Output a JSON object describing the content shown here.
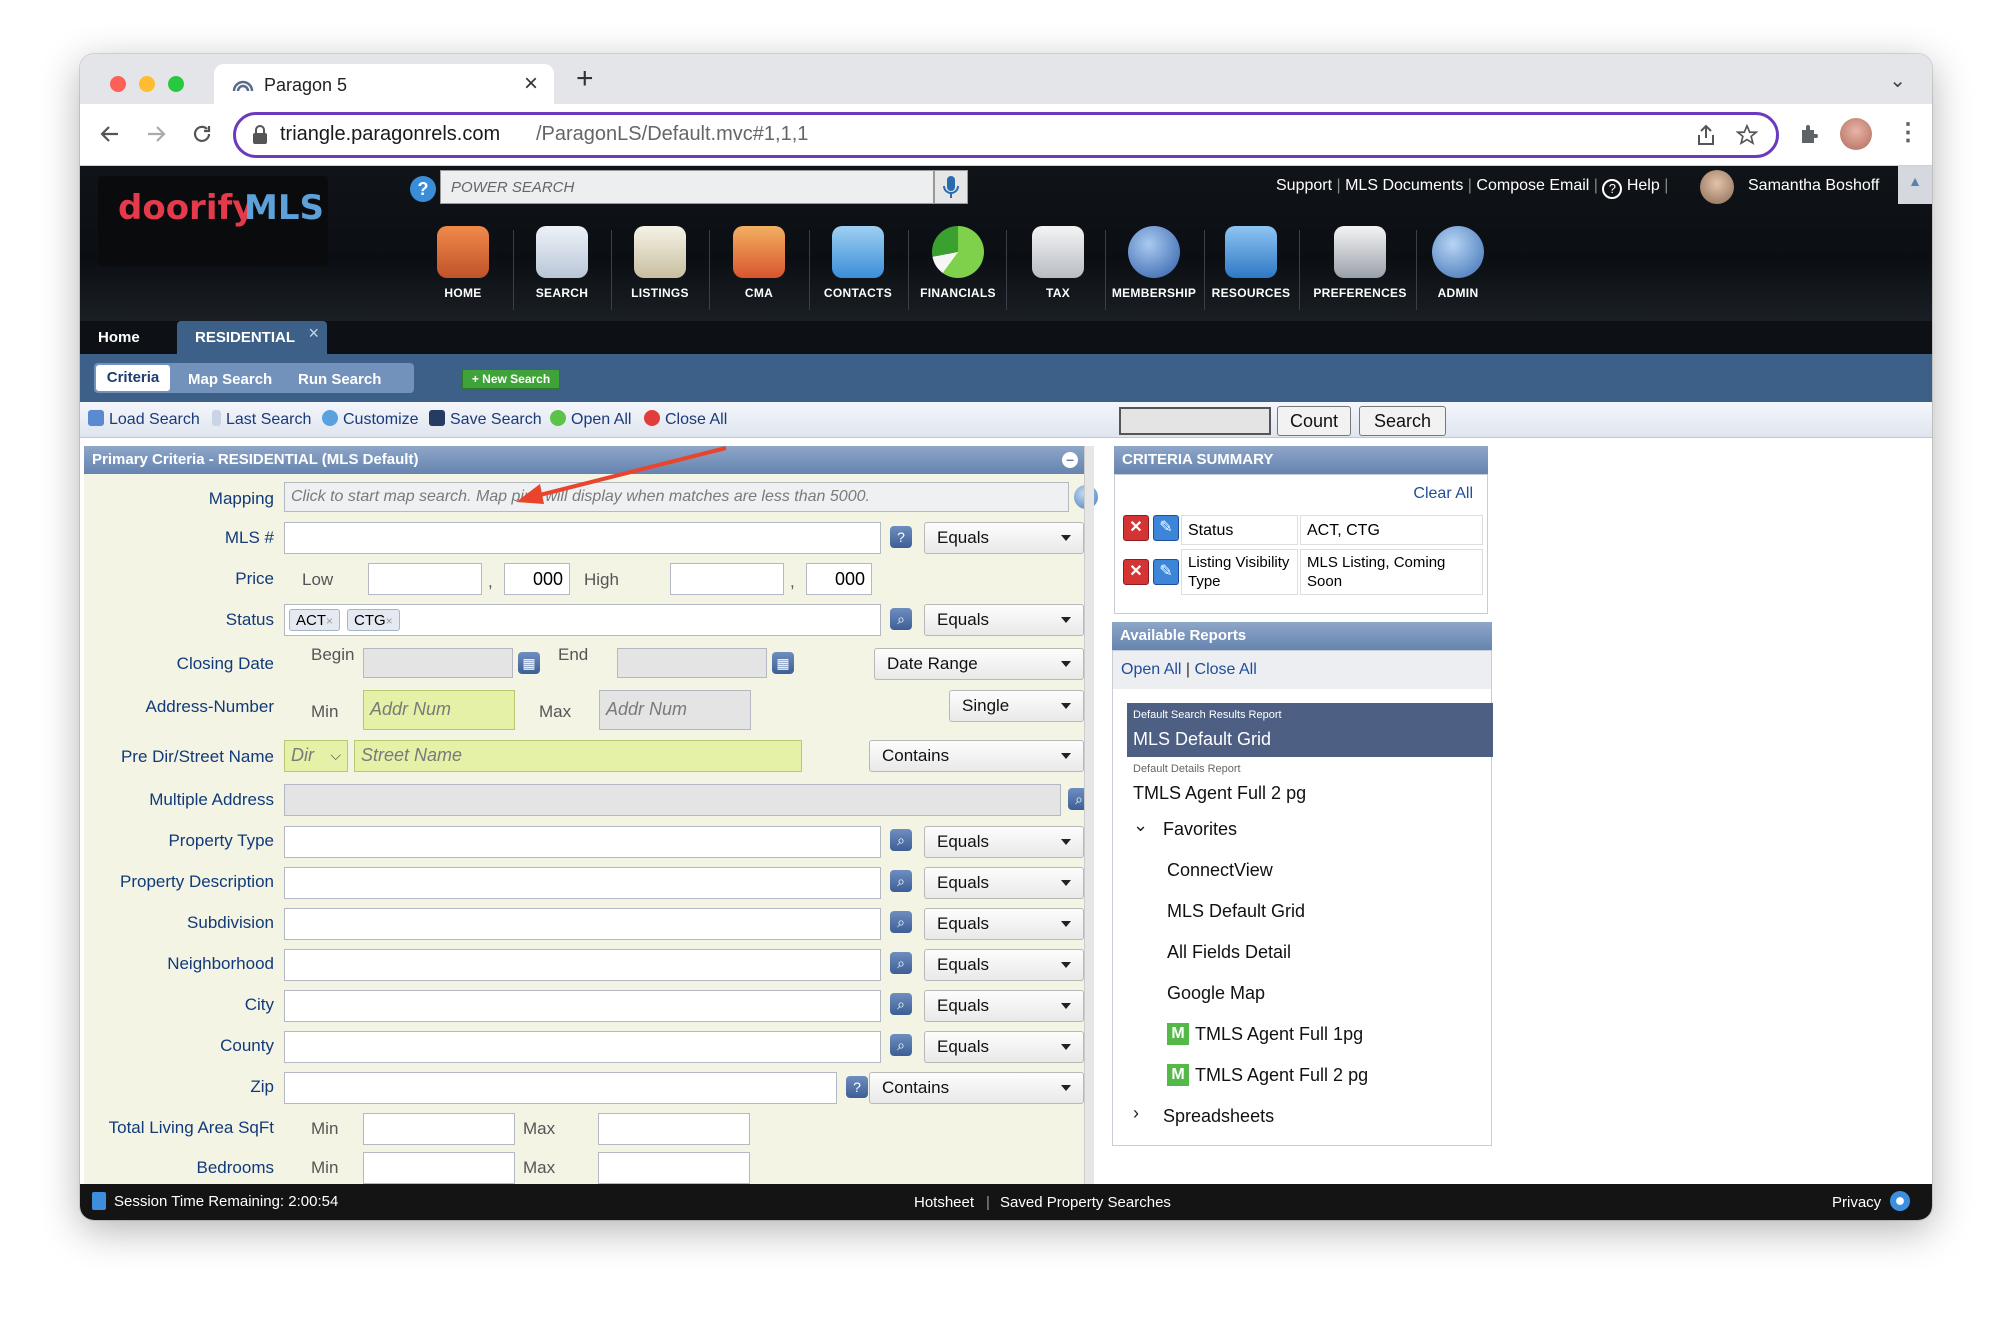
{
  "browser": {
    "tab_title": "Paragon 5",
    "url_host": "triangle.paragonrels.com",
    "url_path": "/ParagonLS/Default.mvc#1,1,1"
  },
  "header": {
    "logo_brand": "doorify",
    "logo_mls": "MLS",
    "power_search_placeholder": "POWER SEARCH",
    "links": [
      "Support",
      "MLS Documents",
      "Compose Email",
      "Help"
    ],
    "user_name": "Samantha Boshoff",
    "nav": [
      "HOME",
      "SEARCH",
      "LISTINGS",
      "CMA",
      "CONTACTS",
      "FINANCIALS",
      "TAX",
      "MEMBERSHIP",
      "RESOURCES",
      "PREFERENCES",
      "ADMIN"
    ]
  },
  "tabs": {
    "home": "Home",
    "residential": "RESIDENTIAL"
  },
  "subtabs": {
    "criteria": "Criteria",
    "map": "Map Search",
    "run": "Run Search",
    "new": "+ New Search"
  },
  "toolbar": {
    "load": "Load Search",
    "last": "Last Search",
    "customize": "Customize",
    "save": "Save Search",
    "open_all": "Open All",
    "close_all": "Close All",
    "count": "Count",
    "search": "Search"
  },
  "criteria": {
    "title": "Primary Criteria - RESIDENTIAL (MLS Default)",
    "mapping_label": "Mapping",
    "mapping_hint": "Click to start map search. Map pins will display when matches are less than 5000.",
    "mls_label": "MLS #",
    "mls_op": "Equals",
    "price_label": "Price",
    "low": "Low",
    "high": "High",
    "thousands": "000",
    "comma": ",",
    "status_label": "Status",
    "status_tags": [
      "ACT",
      "CTG"
    ],
    "status_op": "Equals",
    "closing_label": "Closing Date",
    "begin": "Begin",
    "end": "End",
    "closing_op": "Date Range",
    "addr_label": "Address-Number",
    "min": "Min",
    "max": "Max",
    "addr_ph": "Addr Num",
    "addr_op": "Single",
    "street_label": "Pre Dir/Street Name",
    "dir_ph": "Dir",
    "street_ph": "Street Name",
    "street_op": "Contains",
    "multi_label": "Multiple Address",
    "rows": [
      {
        "label": "Property Type",
        "op": "Equals"
      },
      {
        "label": "Property Description",
        "op": "Equals"
      },
      {
        "label": "Subdivision",
        "op": "Equals"
      },
      {
        "label": "Neighborhood",
        "op": "Equals"
      },
      {
        "label": "City",
        "op": "Equals"
      },
      {
        "label": "County",
        "op": "Equals"
      }
    ],
    "zip_label": "Zip",
    "zip_op": "Contains",
    "sqft_label": "Total Living Area SqFt",
    "bed_label": "Bedrooms"
  },
  "summary": {
    "title": "CRITERIA SUMMARY",
    "clear_all": "Clear All",
    "rows": [
      {
        "field": "Status",
        "value": "ACT, CTG"
      },
      {
        "field": "Listing Visibility Type",
        "value": "MLS Listing, Coming Soon"
      }
    ]
  },
  "reports": {
    "title": "Available Reports",
    "open_all": "Open All",
    "close_all": "Close All",
    "default_search_caption": "Default Search Results Report",
    "default_search": "MLS Default Grid",
    "default_details_caption": "Default Details Report",
    "default_details": "TMLS Agent Full 2 pg",
    "favorites": "Favorites",
    "items": [
      "ConnectView",
      "MLS Default Grid",
      "All Fields Detail",
      "Google Map"
    ],
    "m_items": [
      "TMLS Agent Full 1pg",
      "TMLS Agent Full 2 pg"
    ],
    "spreadsheets": "Spreadsheets"
  },
  "footer": {
    "session": "Session Time Remaining: 2:00:54",
    "hotsheet": "Hotsheet",
    "saved": "Saved Property Searches",
    "privacy": "Privacy"
  },
  "colors": {
    "accent_purple": "#6c3bbd",
    "subnav_blue": "#3d6089",
    "field_green": "#e5f1a7",
    "annotation_arrow": "#e8452c"
  }
}
